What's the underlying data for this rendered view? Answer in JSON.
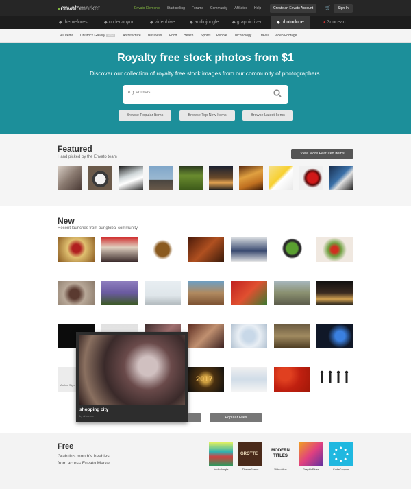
{
  "header": {
    "logo_main": "envato",
    "logo_sub": "market",
    "links": [
      "Envato Elements",
      "Start selling",
      "Forums",
      "Community",
      "Affiliates",
      "Help"
    ],
    "create_account": "Create an Envato Account",
    "sign_in": "Sign In"
  },
  "marketplaces": [
    "themeforest",
    "codecanyon",
    "videohive",
    "audiojungle",
    "graphicriver",
    "photodune",
    "3docean"
  ],
  "active_marketplace": "photodune",
  "categories": [
    "All Items",
    "Unistock Gallery",
    "Architecture",
    "Business",
    "Food",
    "Health",
    "Sports",
    "People",
    "Technology",
    "Travel",
    "Video Footage"
  ],
  "new_badge": "NEW",
  "hero": {
    "title": "Royalty free stock photos from $1",
    "subtitle": "Discover our collection of royalty free stock images from our community of photographers.",
    "search_placeholder": "e.g. animals",
    "buttons": [
      "Browse Popular Items",
      "Browse Top New Items",
      "Browse Latest Items"
    ]
  },
  "featured": {
    "title": "Featured",
    "subtitle": "Hand picked by the Envato team",
    "more_button": "View More Featured Items"
  },
  "new_section": {
    "title": "New",
    "subtitle": "Recent launches from our global community"
  },
  "popup": {
    "title": "shopping city",
    "by": "by ahslema"
  },
  "popular_files": "Popular Files",
  "thumb_text": {
    "year": "2017",
    "sign": "Author Sign"
  },
  "free": {
    "title": "Free",
    "desc": "Grab this month's freebies from across Envato Market",
    "items": [
      {
        "label": "AudioJungle",
        "overlay": ""
      },
      {
        "label": "ThemeForest",
        "overlay": "GROTTE"
      },
      {
        "label": "VideoHive",
        "overlay": "MODERN TITLES"
      },
      {
        "label": "GraphicRiver",
        "overlay": ""
      },
      {
        "label": "CodeCanyon",
        "overlay": ""
      }
    ]
  },
  "colors": {
    "hero_bg": "#1c8f9a",
    "brand_green": "#82b541",
    "topbar_bg": "#262626"
  }
}
